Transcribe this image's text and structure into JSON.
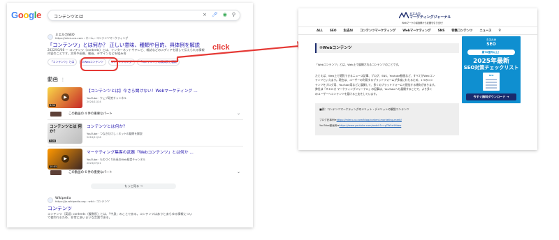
{
  "serp": {
    "logo": [
      "G",
      "o",
      "o",
      "g",
      "l",
      "e"
    ],
    "logo_colors": [
      "#4285f4",
      "#ea4335",
      "#fbbc05",
      "#4285f4",
      "#34a853",
      "#ea4335"
    ],
    "search_query": "コンテンツとは",
    "icons": {
      "clear": "×",
      "mic": "🎤︎",
      "lens": "◉",
      "search": "⚲"
    },
    "result1": {
      "site_name": "ミエルカSEO",
      "site_url": "https://mieru-ca.com › ホーム › コンテンツマーケティング",
      "title": "「コンテンツ」とは何か？ 正しい意味、種類や目的、具体例を解説",
      "snippet1": "2022/03/08 — コンテンツ（contents）とは、インターネットやテレビ、雑誌などのメディアを通して伝えられる情報",
      "snippet2": "内容のことです。文章や画像、動画、デザインなどを組み合",
      "chips": [
        "「コンテンツ」とは",
        "②Webコンテンツ",
        "③マーケティング",
        "「コンテンツ」の具体例と種類"
      ]
    },
    "videos_heading": "動画",
    "videos": [
      {
        "title": "【コンテンツとは】今さら聞けない！Webマーケティング ...",
        "channel": "YouTube · ウェブ研究チャンネル",
        "date": "2024/11/14",
        "duration": "6:34",
        "thumb_text": "",
        "thumb_colors": [
          "#f9d648",
          "#c62828"
        ]
      },
      {
        "title": "コンテンツとは何か？",
        "channel": "YouTube · つなきだけし / ネットの疑問を解説",
        "date": "2018/11/16",
        "duration": "7:00",
        "thumb_text": "コンテンツとは 何か？",
        "thumb_colors": [
          "#e8e8e8",
          "#bdbdbd"
        ]
      },
      {
        "title": "マーケティング集客の武器「Webコンテンツ」とは何か ...",
        "channel": "YouTube · ものづくり社長のWeb経営チャンネル",
        "date": "2023/07/21",
        "duration": "10:05",
        "thumb_text": "",
        "thumb_colors": [
          "#ff9800",
          "#3e2723"
        ]
      }
    ],
    "key_moments": "この動画の 4 件の重要なパート",
    "key_moments_2": "この動画の 6 件の重要なパート",
    "more_button": "もっと見る",
    "wiki": {
      "site_name": "Wikipedia",
      "site_url": "https://ja.wikipedia.org › wiki › コンテンツ",
      "title": "コンテンツ",
      "snippet1": "コンテンツ（英語: contents（複数形）とは、「中身」のことである。コンテンツはありとあらゆる情報につい",
      "snippet2": "て使われるため、非常にあいまいな言葉である。"
    }
  },
  "annotation": {
    "click_label": "click",
    "color": "#e53935"
  },
  "article": {
    "logo_top": "ミエルカ",
    "logo_name": "マーケティングジャーナル",
    "logo_sub": "Webマーケの最適解から武器を引き出せ！",
    "nav": [
      "ALL",
      "SEO",
      "生成AI",
      "コンテンツマーケティング",
      "Webマーケティング",
      "SNS",
      "特集コンテンツ",
      "ニュース"
    ],
    "heading": "②Webコンテンツ",
    "p1": "「Webコンテンツ」とは、Web上で展開されるコンテンツのことです。",
    "p2_l1": "たとえば、Web上で閲覧できるニュース記事、ブログ、SNS、Youtube動画など、すべてがWebコン",
    "p2_l2": "テンツといえます。現在は、ユーザーの利用するプラットフォームが多岐にわたるため、1つのコン",
    "p2_l3": "テンツをブログ用、YouTube用などに展開して、多くのプラットフォームで配信する傾向があります。",
    "p2_l4": "弊社は「ミエルカ マーケティングジャーナル」の記事は、YouTubeへも展開することで、より多く",
    "p2_l5": "のユーザーへコンテンツを届ける工夫をしています。",
    "related_heading": "■例：コンテンツマーケティングのメリット・デメリットの解説コンテンツ",
    "related_blog_label": "ブログ記事例➡",
    "related_blog_url": "https://mieru-ca.com/blog/content-marketing-merit/",
    "related_yt_label": "YouTube動画例➡",
    "related_yt_url": "https://www.youtube.com/watch?v=gTWkrHHdeo",
    "banner": {
      "logo": "ミエルカ",
      "seo": "SEO",
      "badge": "累70億件以上！",
      "year": "2025年最新",
      "title": "SEO対策チェックリスト",
      "doc_title": "SEO",
      "cta": "今すぐ無料ダウンロード ➔"
    }
  }
}
